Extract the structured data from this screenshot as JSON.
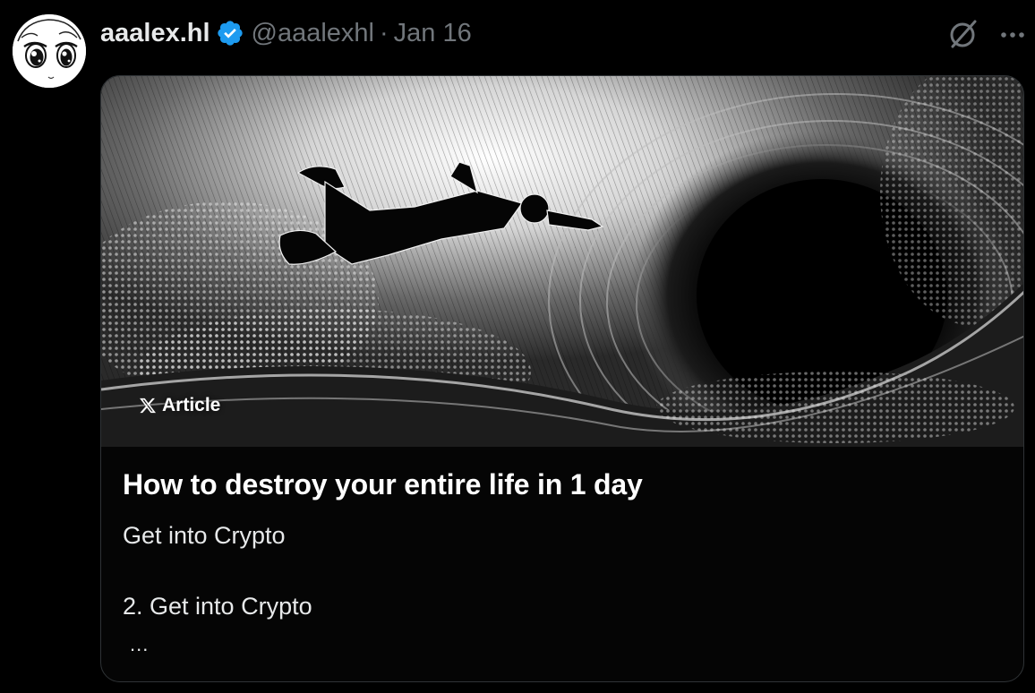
{
  "author": {
    "display_name": "aaalex.hl",
    "handle": "@aaalexhl",
    "separator": "·",
    "date": "Jan 16",
    "verified": true
  },
  "icons": {
    "grok": "grok-icon",
    "more": "more-icon",
    "verified": "verified-badge-icon",
    "x_logo": "x-logo-icon"
  },
  "article": {
    "badge_label": "Article",
    "title": "How to destroy your entire life in 1 day",
    "body_lines": [
      "Get into Crypto",
      "2. Get into Crypto"
    ],
    "truncation": "..."
  },
  "colors": {
    "background": "#000000",
    "verified_blue": "#1d9bf0",
    "muted_text": "#71767b",
    "border": "#2f3336"
  }
}
